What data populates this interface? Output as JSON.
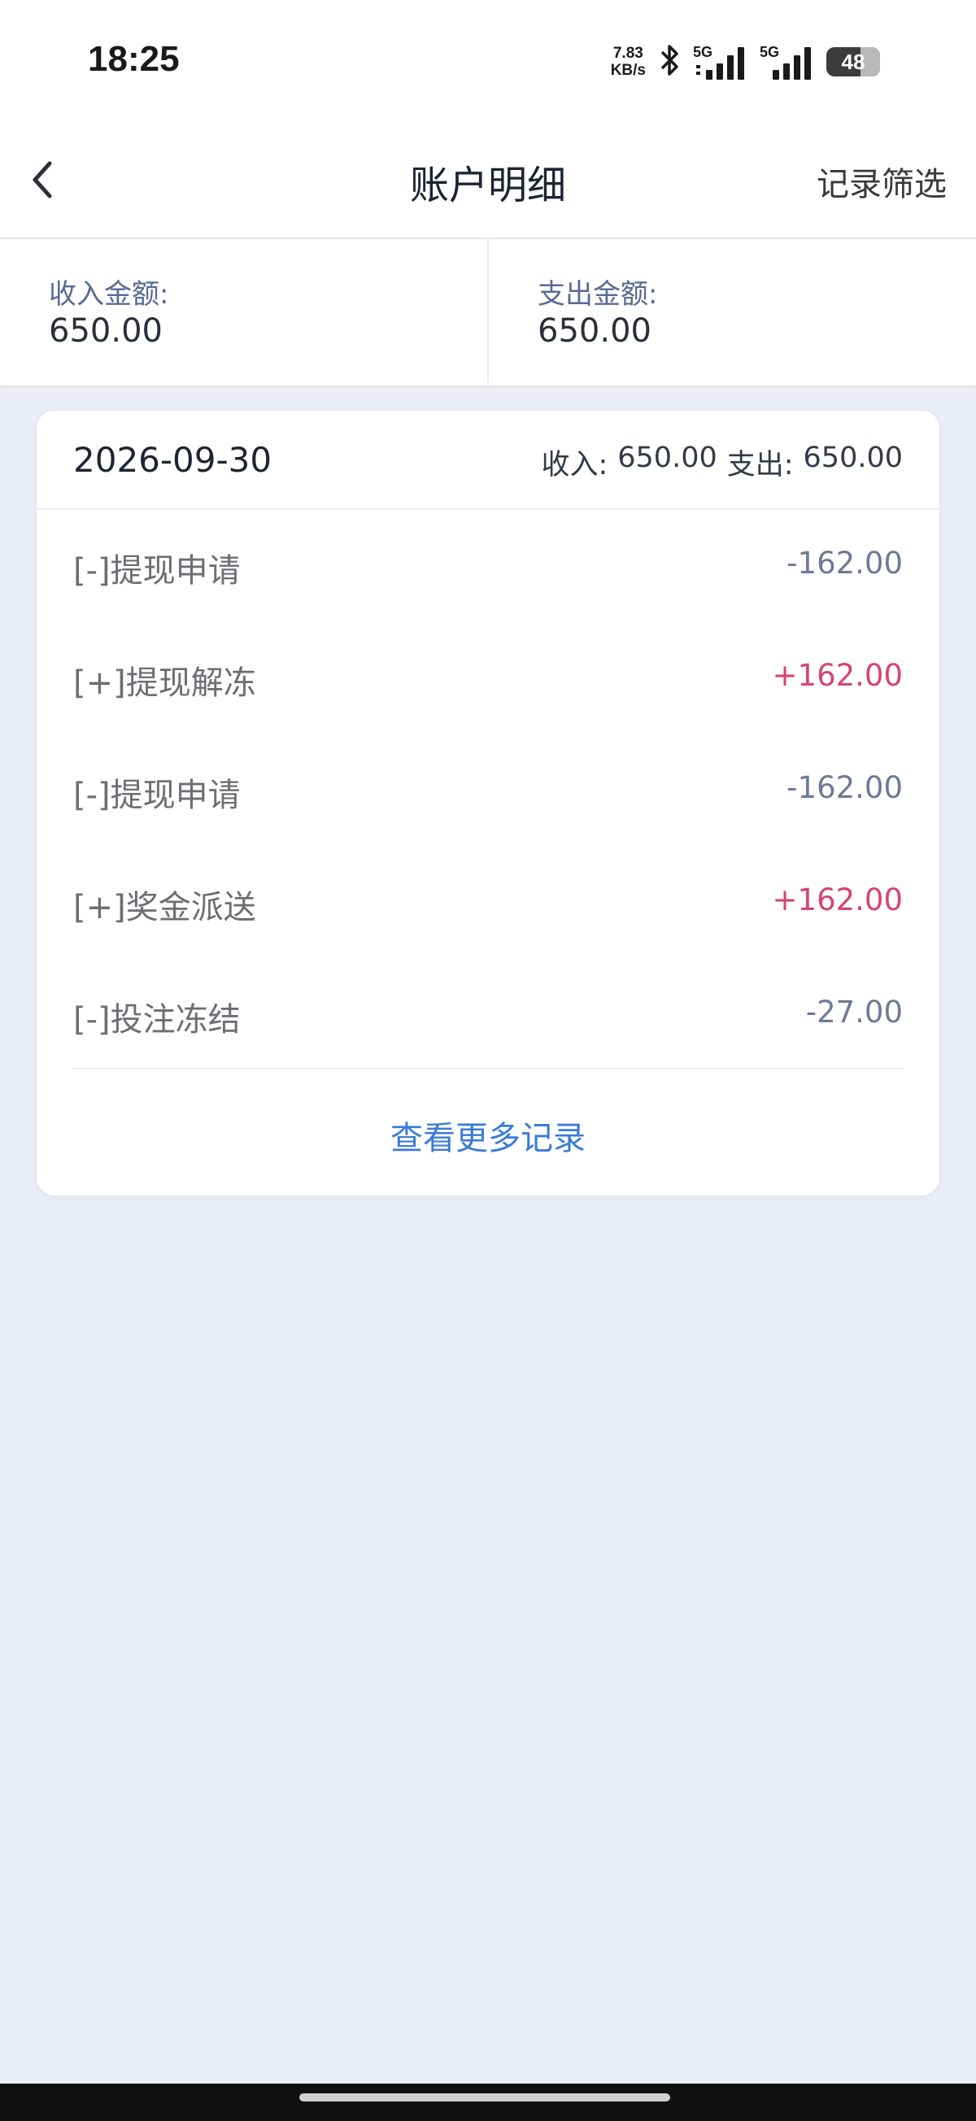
{
  "status_bar": {
    "time": "18:25",
    "net_speed_value": "7.83",
    "net_speed_unit": "KB/s",
    "sim1_label": "5G",
    "sim2_label": "5G",
    "battery": "48",
    "icons": [
      "bluetooth-icon",
      "signal-icon",
      "signal-icon",
      "battery-icon"
    ]
  },
  "header": {
    "back_icon": "chevron-left-icon",
    "title": "账户明细",
    "action_label": "记录筛选"
  },
  "summary": {
    "income_label": "收入金额:",
    "income_value": "650.00",
    "expense_label": "支出金额:",
    "expense_value": "650.00"
  },
  "day_card": {
    "date": "2026-09-30",
    "income_label": "收入:",
    "income_value": "650.00",
    "expense_label": "支出:",
    "expense_value": "650.00",
    "records": [
      {
        "label": "[-]提现申请",
        "amount": "-162.00",
        "type": "negative"
      },
      {
        "label": "[+]提现解冻",
        "amount": "+162.00",
        "type": "positive"
      },
      {
        "label": "[-]提现申请",
        "amount": "-162.00",
        "type": "negative"
      },
      {
        "label": "[+]奖金派送",
        "amount": "+162.00",
        "type": "positive"
      },
      {
        "label": "[-]投注冻结",
        "amount": "-27.00",
        "type": "negative"
      }
    ],
    "more_label": "查看更多记录"
  },
  "colors": {
    "positive": "#d6456e",
    "negative": "#6e7a96",
    "link": "#3b7ad9",
    "background": "#ebeef7"
  }
}
